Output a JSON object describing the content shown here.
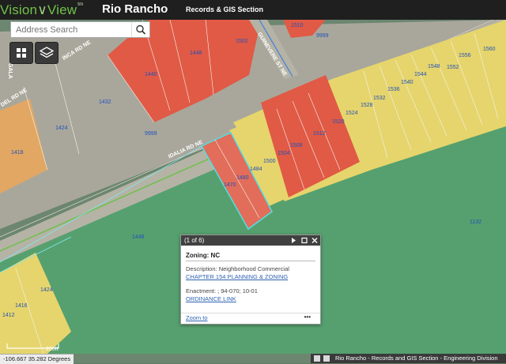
{
  "header": {
    "logo_part1": "Vision",
    "logo_part2": "View",
    "logo_tm": "tm",
    "app_title": "Rio Rancho",
    "section_title": "Records & GIS Section"
  },
  "search": {
    "placeholder": "Address Search"
  },
  "tools": {
    "basemap_icon": "grid-icon",
    "layers_icon": "layers-icon"
  },
  "colors": {
    "zoning_red": "#e2574a",
    "zoning_yellow": "#e4d46d",
    "zoning_green": "#4fa06d",
    "zoning_orange": "#e3a35c",
    "road_gray": "#a7a79e"
  },
  "roads": [
    "INCA RD NE",
    "IDALIA RD NE",
    "GUINEVERE ST NE",
    "GALA",
    "DEL RD NE"
  ],
  "parcel_labels": [
    "1510",
    "9999",
    "1502",
    "1448",
    "1440",
    "1432",
    "1424",
    "1418",
    "9999",
    "1556",
    "1560",
    "1548",
    "1552",
    "1544",
    "1540",
    "1536",
    "1532",
    "1528",
    "1524",
    "1520",
    "1512",
    "1508",
    "1504",
    "1500",
    "1484",
    "1480",
    "1470",
    "1132",
    "1448",
    "1424",
    "1416",
    "1412"
  ],
  "popup": {
    "counter": "(1 of 6)",
    "title": "Zoning: NC",
    "description_label": "Description:",
    "description_value": "Neighborhood Commercial",
    "chapter_link": "CHAPTER 154 PLANNING & ZONING",
    "enactment_label": "Enactment:",
    "enactment_value": "; 94-070; 10-01",
    "ordinance_link": "ORDINANCE LINK",
    "zoom_link": "Zoom to",
    "more_label": "•••"
  },
  "scale": {
    "label": "200ft"
  },
  "coordinates": "-106.667 35.282 Degrees",
  "attribution": "Rio Rancho - Records and GIS Section - Engineering Division"
}
